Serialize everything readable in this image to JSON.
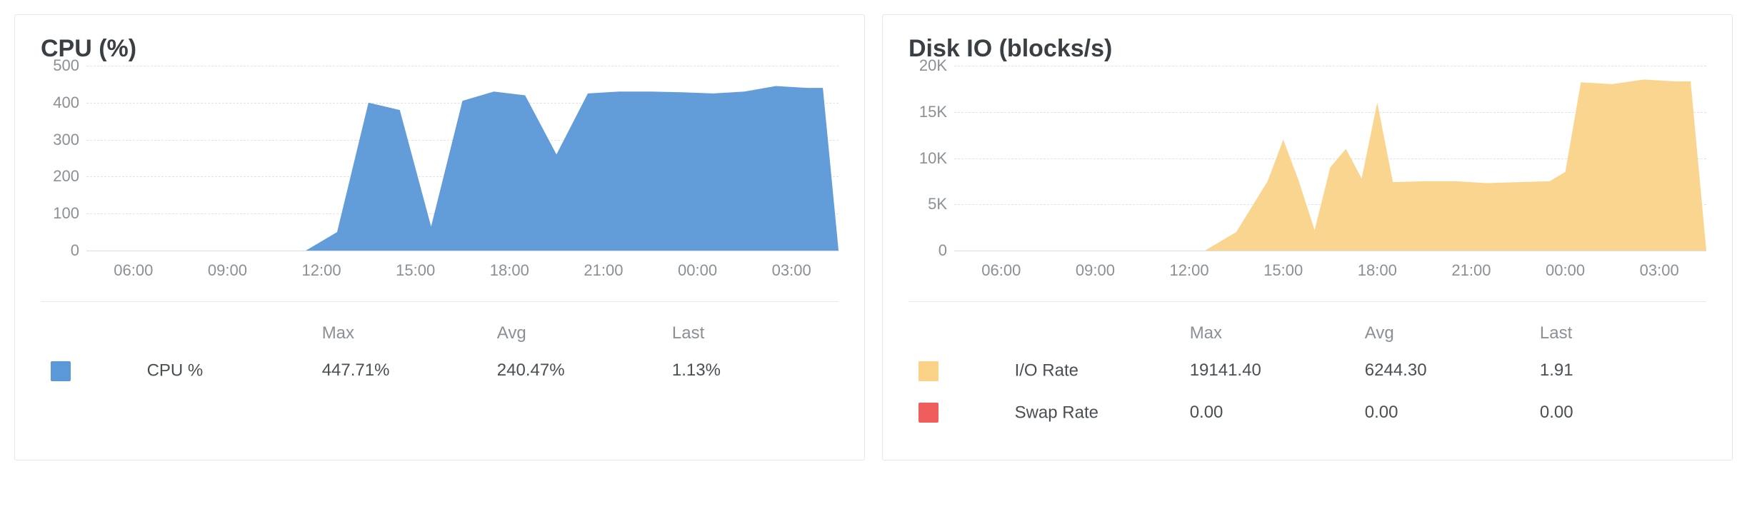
{
  "panels": [
    {
      "id": "cpu",
      "title": "CPU (%)",
      "stat_headers": [
        "Max",
        "Avg",
        "Last"
      ],
      "series_legend": [
        {
          "name": "CPU %",
          "color": "#5a98d8",
          "stats": [
            "447.71%",
            "240.47%",
            "1.13%"
          ]
        }
      ]
    },
    {
      "id": "diskio",
      "title": "Disk IO (blocks/s)",
      "stat_headers": [
        "Max",
        "Avg",
        "Last"
      ],
      "series_legend": [
        {
          "name": "I/O Rate",
          "color": "#fad389",
          "stats": [
            "19141.40",
            "6244.30",
            "1.91"
          ]
        },
        {
          "name": "Swap Rate",
          "color": "#ef5d5d",
          "stats": [
            "0.00",
            "0.00",
            "0.00"
          ]
        }
      ]
    }
  ],
  "chart_data": [
    {
      "type": "area",
      "title": "CPU (%)",
      "xlabel": "",
      "ylabel": "",
      "ylim": [
        0,
        500
      ],
      "y_ticks": [
        0,
        100,
        200,
        300,
        400,
        500
      ],
      "x_tick_labels": [
        "06:00",
        "09:00",
        "12:00",
        "15:00",
        "18:00",
        "21:00",
        "00:00",
        "03:00"
      ],
      "series": [
        {
          "name": "CPU %",
          "color": "#5a98d8",
          "x": [
            0,
            5,
            6,
            7,
            8,
            9,
            10,
            11,
            12,
            13,
            14,
            15,
            16,
            17,
            18,
            19,
            20,
            21,
            22,
            23,
            23.5,
            24
          ],
          "values": [
            0,
            0,
            0,
            0,
            50,
            400,
            380,
            65,
            405,
            430,
            420,
            260,
            425,
            430,
            430,
            428,
            425,
            430,
            445,
            440,
            440,
            1.1
          ]
        }
      ]
    },
    {
      "type": "area",
      "title": "Disk IO (blocks/s)",
      "xlabel": "",
      "ylabel": "",
      "ylim": [
        0,
        20000
      ],
      "y_ticks": [
        0,
        5000,
        10000,
        15000,
        20000
      ],
      "y_tick_labels": [
        "0",
        "5K",
        "10K",
        "15K",
        "20K"
      ],
      "x_tick_labels": [
        "06:00",
        "09:00",
        "12:00",
        "15:00",
        "18:00",
        "21:00",
        "00:00",
        "03:00"
      ],
      "series": [
        {
          "name": "I/O Rate",
          "color": "#fad389",
          "x": [
            0,
            5,
            6,
            7,
            8,
            9,
            10,
            10.5,
            11,
            11.5,
            12,
            12.5,
            13,
            13.5,
            14,
            15,
            16,
            17,
            18,
            19,
            19.5,
            20,
            21,
            22,
            23,
            23.5,
            24
          ],
          "values": [
            0,
            0,
            0,
            0,
            0,
            2000,
            7500,
            12000,
            7500,
            2200,
            9000,
            11000,
            7800,
            16000,
            7400,
            7500,
            7500,
            7300,
            7400,
            7500,
            8500,
            18200,
            18000,
            18500,
            18300,
            18300,
            2
          ]
        },
        {
          "name": "Swap Rate",
          "color": "#ef5d5d",
          "x": [
            0,
            24
          ],
          "values": [
            0,
            0
          ]
        }
      ]
    }
  ]
}
